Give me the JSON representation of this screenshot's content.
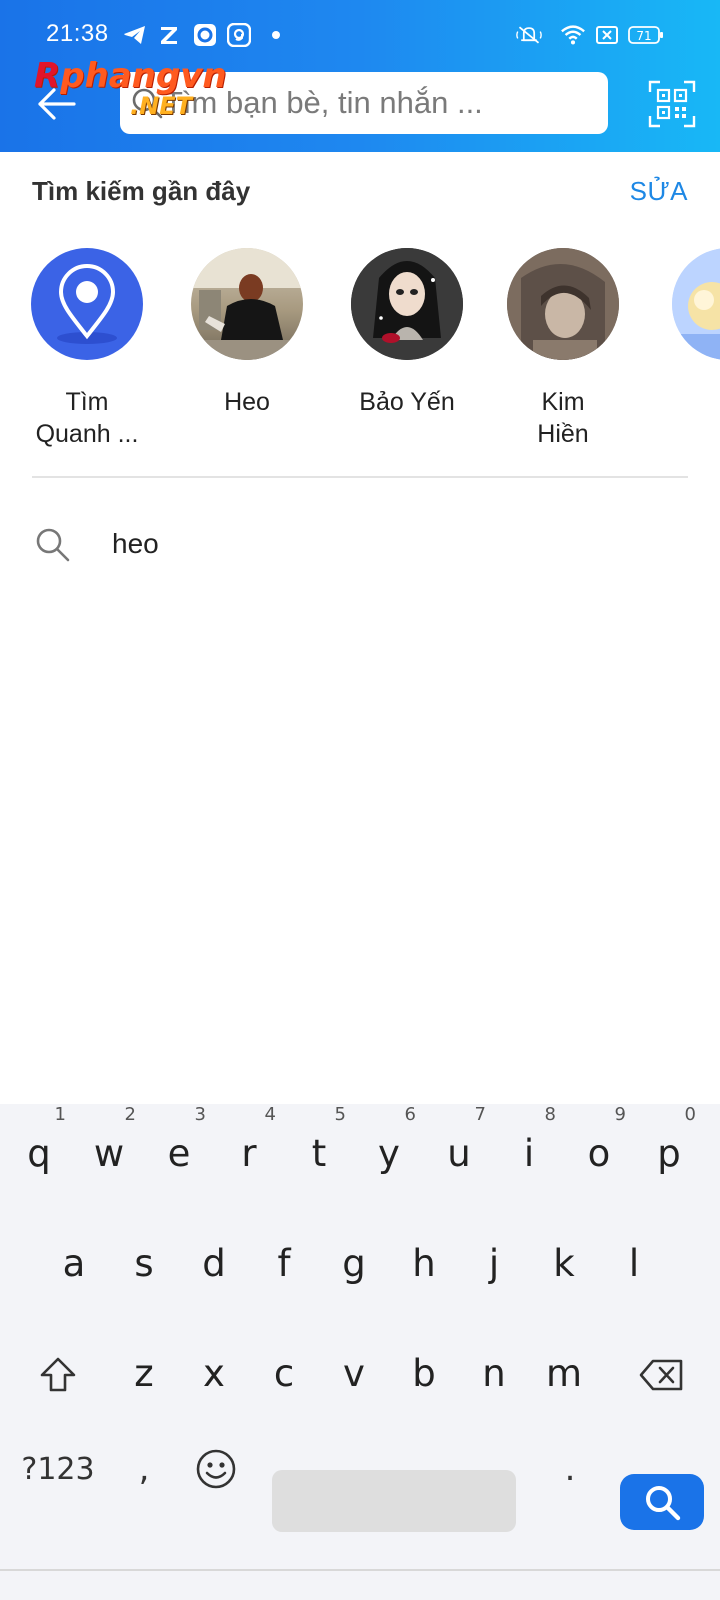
{
  "statusbar": {
    "time": "21:38",
    "battery": "71",
    "icons": [
      "telegram-icon",
      "zalo-icon",
      "messenger-icon",
      "app-icon",
      "mute-icon",
      "wifi-icon",
      "no-sim-icon",
      "battery-icon"
    ]
  },
  "header": {
    "search_placeholder": "Tìm bạn bè, tin nhắn ...",
    "watermark_main_1": "R",
    "watermark_main_2": "phangvn",
    "watermark_sub": ".NET"
  },
  "recent": {
    "title": "Tìm kiếm gần đây",
    "edit_label": "SỬA",
    "items": [
      {
        "label_line1": "Tìm",
        "label_line2": "Quanh ..."
      },
      {
        "label_line1": "Heo",
        "label_line2": ""
      },
      {
        "label_line1": "Bảo Yến",
        "label_line2": ""
      },
      {
        "label_line1": "Kim",
        "label_line2": "Hiền"
      }
    ]
  },
  "history": {
    "items": [
      {
        "text": "heo"
      }
    ]
  },
  "keyboard": {
    "row1": [
      "q",
      "w",
      "e",
      "r",
      "t",
      "y",
      "u",
      "i",
      "o",
      "p"
    ],
    "row1_nums": [
      "1",
      "2",
      "3",
      "4",
      "5",
      "6",
      "7",
      "8",
      "9",
      "0"
    ],
    "row2": [
      "a",
      "s",
      "d",
      "f",
      "g",
      "h",
      "j",
      "k",
      "l"
    ],
    "row3": [
      "z",
      "x",
      "c",
      "v",
      "b",
      "n",
      "m"
    ],
    "symbols_label": "?123",
    "comma": ",",
    "period": "."
  },
  "colors": {
    "header_start": "#1a73e8",
    "header_end": "#18b8f6",
    "accent": "#1e88e5",
    "keyboard_bg": "#f3f4f8"
  }
}
